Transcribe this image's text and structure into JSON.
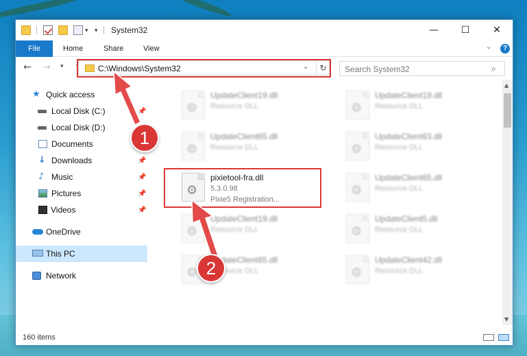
{
  "window": {
    "title": "System32",
    "controls": {
      "minimize": "—",
      "maximize": "☐",
      "close": "✕"
    }
  },
  "ribbon": {
    "tabs": [
      {
        "label": "File"
      },
      {
        "label": "Home"
      },
      {
        "label": "Share"
      },
      {
        "label": "View"
      }
    ],
    "help": "?"
  },
  "nav": {
    "address": "C:\\Windows\\System32",
    "search_placeholder": "Search System32"
  },
  "sidebar": {
    "items": [
      {
        "label": "Quick access",
        "icon": "star-icon",
        "pinned": false
      },
      {
        "label": "Local Disk (C:)",
        "icon": "disk-icon",
        "pinned": true
      },
      {
        "label": "Local Disk (D:)",
        "icon": "disk-icon",
        "pinned": false
      },
      {
        "label": "Documents",
        "icon": "documents-icon",
        "pinned": true
      },
      {
        "label": "Downloads",
        "icon": "download-icon",
        "pinned": true
      },
      {
        "label": "Music",
        "icon": "music-icon",
        "pinned": true
      },
      {
        "label": "Pictures",
        "icon": "pictures-icon",
        "pinned": true
      },
      {
        "label": "Videos",
        "icon": "videos-icon",
        "pinned": true
      },
      {
        "label": "OneDrive",
        "icon": "onedrive-icon",
        "pinned": false
      },
      {
        "label": "This PC",
        "icon": "this-pc-icon",
        "pinned": false,
        "selected": true
      },
      {
        "label": "Network",
        "icon": "network-icon",
        "pinned": false
      }
    ]
  },
  "files": [
    {
      "name": "UpdateClient19.dll",
      "line2": "Resource DLL",
      "line3": "",
      "blurred": true
    },
    {
      "name": "UpdateClient19.dll",
      "line2": "Resource DLL",
      "line3": "",
      "blurred": true
    },
    {
      "name": "UpdateClient65.dll",
      "line2": "Resource DLL",
      "line3": "",
      "blurred": true
    },
    {
      "name": "UpdateClient63.dll",
      "line2": "Resource DLL",
      "line3": "",
      "blurred": true
    },
    {
      "name": "pixietool-fra.dll",
      "line2": "5.3.0.98",
      "line3": "Pixie5 Registration...",
      "blurred": false,
      "highlighted": true
    },
    {
      "name": "UpdateClient65.dll",
      "line2": "Resource DLL",
      "line3": "",
      "blurred": true
    },
    {
      "name": "UpdateClient19.dll",
      "line2": "Resource DLL",
      "line3": "",
      "blurred": true
    },
    {
      "name": "UpdateClient5.dll",
      "line2": "Resource DLL",
      "line3": "",
      "blurred": true
    },
    {
      "name": "UpdateClient65.dll",
      "line2": "Resource DLL",
      "line3": "",
      "blurred": true
    },
    {
      "name": "UpdateClient42.dll",
      "line2": "Resource DLL",
      "line3": "",
      "blurred": true
    }
  ],
  "status": {
    "item_count": "160 items"
  },
  "annotations": {
    "step1": "1",
    "step2": "2",
    "color": "#d93636"
  }
}
